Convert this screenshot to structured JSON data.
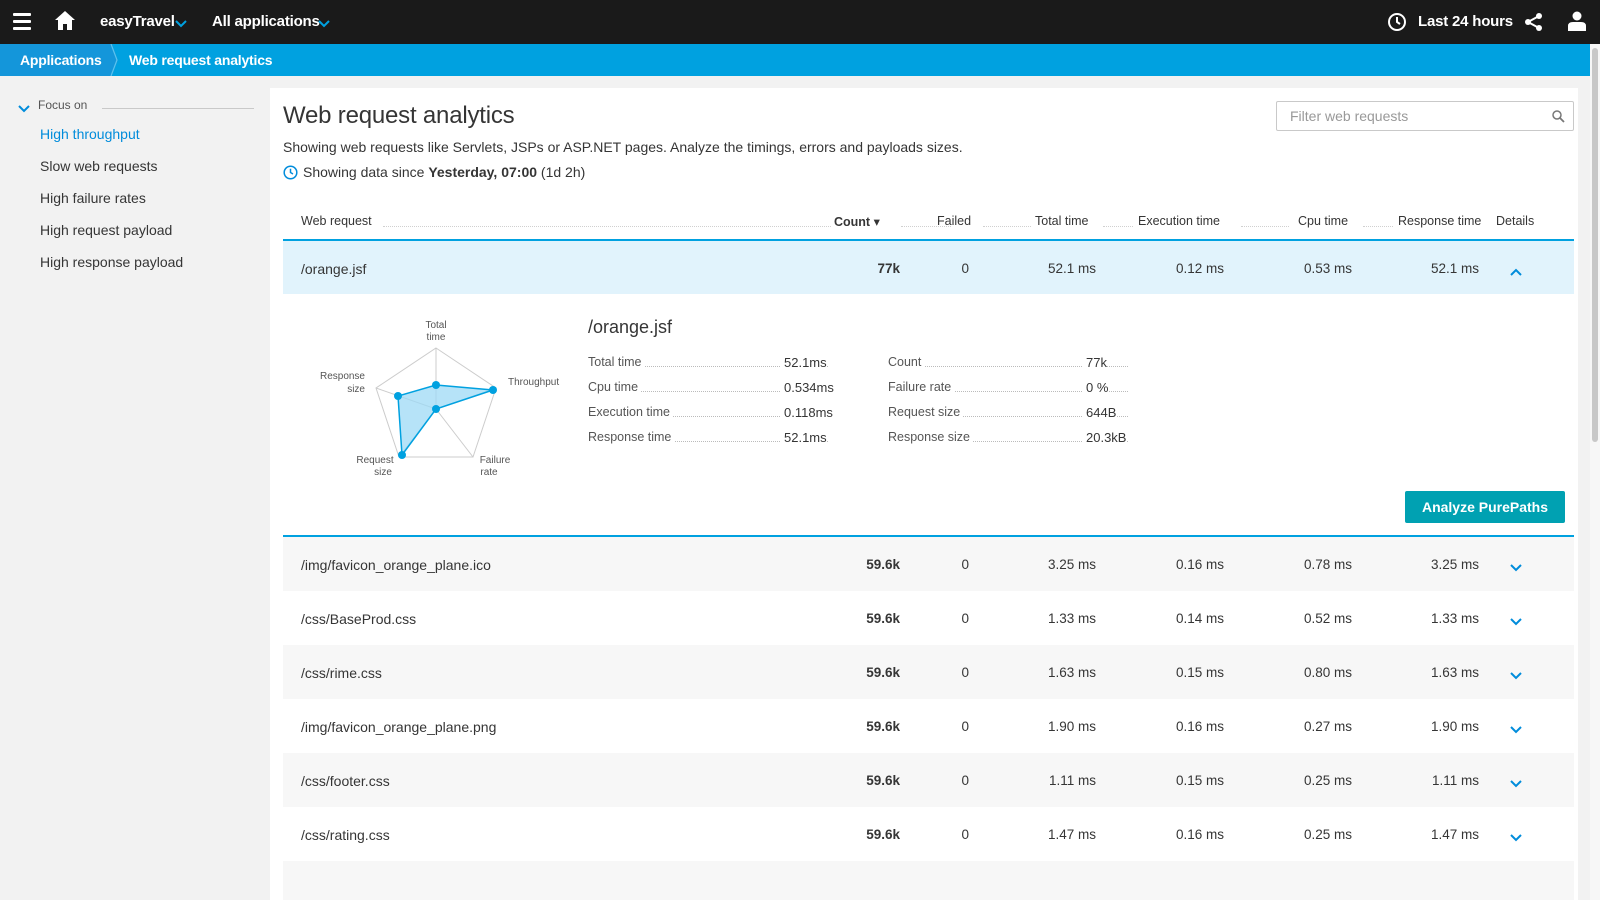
{
  "topbar": {
    "environment": "easyTravel",
    "applications": "All applications",
    "timeframe": "Last 24 hours"
  },
  "breadcrumb": {
    "parent": "Applications",
    "current": "Web request analytics"
  },
  "sidebar": {
    "heading": "Focus on",
    "items": [
      {
        "label": "High throughput",
        "active": true
      },
      {
        "label": "Slow web requests"
      },
      {
        "label": "High failure rates"
      },
      {
        "label": "High request payload"
      },
      {
        "label": "High response payload"
      }
    ]
  },
  "main": {
    "title": "Web request analytics",
    "subtitle": "Showing web requests like Servlets, JSPs or ASP.NET pages. Analyze the timings, errors and payloads sizes.",
    "since_prefix": "Showing data since",
    "since_value": "Yesterday, 07:00",
    "since_suffix": "(1d 2h)",
    "filter_placeholder": "Filter web requests"
  },
  "table": {
    "columns": {
      "name": "Web request",
      "count": "Count ▾",
      "failed": "Failed",
      "total_time": "Total time",
      "execution_time": "Execution time",
      "cpu_time": "Cpu time",
      "response_time": "Response time",
      "details": "Details"
    },
    "selected": {
      "name": "/orange.jsf",
      "count": "77k",
      "failed": "0",
      "total_time": "52.1 ms",
      "execution_time": "0.12 ms",
      "cpu_time": "0.53 ms",
      "response_time": "52.1 ms"
    },
    "rows": [
      {
        "name": "/img/favicon_orange_plane.ico",
        "count": "59.6k",
        "failed": "0",
        "total_time": "3.25 ms",
        "execution_time": "0.16 ms",
        "cpu_time": "0.78 ms",
        "response_time": "3.25 ms"
      },
      {
        "name": "/css/BaseProd.css",
        "count": "59.6k",
        "failed": "0",
        "total_time": "1.33 ms",
        "execution_time": "0.14 ms",
        "cpu_time": "0.52 ms",
        "response_time": "1.33 ms"
      },
      {
        "name": "/css/rime.css",
        "count": "59.6k",
        "failed": "0",
        "total_time": "1.63 ms",
        "execution_time": "0.15 ms",
        "cpu_time": "0.80 ms",
        "response_time": "1.63 ms"
      },
      {
        "name": "/img/favicon_orange_plane.png",
        "count": "59.6k",
        "failed": "0",
        "total_time": "1.90 ms",
        "execution_time": "0.16 ms",
        "cpu_time": "0.27 ms",
        "response_time": "1.90 ms"
      },
      {
        "name": "/css/footer.css",
        "count": "59.6k",
        "failed": "0",
        "total_time": "1.11 ms",
        "execution_time": "0.15 ms",
        "cpu_time": "0.25 ms",
        "response_time": "1.11 ms"
      },
      {
        "name": "/css/rating.css",
        "count": "59.6k",
        "failed": "0",
        "total_time": "1.47 ms",
        "execution_time": "0.16 ms",
        "cpu_time": "0.25 ms",
        "response_time": "1.47 ms"
      }
    ]
  },
  "detail": {
    "title": "/orange.jsf",
    "radar_labels": {
      "total_time_1": "Total",
      "total_time_2": "time",
      "throughput": "Throughput",
      "failure_rate_1": "Failure",
      "failure_rate_2": "rate",
      "request_size_1": "Request",
      "request_size_2": "size",
      "response_size_1": "Response",
      "response_size_2": "size"
    },
    "metrics_left": [
      {
        "label": "Total time",
        "value": "52.1ms"
      },
      {
        "label": "Cpu time",
        "value": "0.534ms"
      },
      {
        "label": "Execution time",
        "value": "0.118ms"
      },
      {
        "label": "Response time",
        "value": "52.1ms"
      }
    ],
    "metrics_right": [
      {
        "label": "Count",
        "value": "77k"
      },
      {
        "label": "Failure rate",
        "value": "0 %"
      },
      {
        "label": "Request size",
        "value": "644B"
      },
      {
        "label": "Response size",
        "value": "20.3kB"
      }
    ],
    "action_label": "Analyze PurePaths"
  },
  "colors": {
    "accent": "#00a1e0",
    "topbar": "#1a1a1a",
    "button": "#00a1b2",
    "selected_row": "#e1f3fc"
  }
}
